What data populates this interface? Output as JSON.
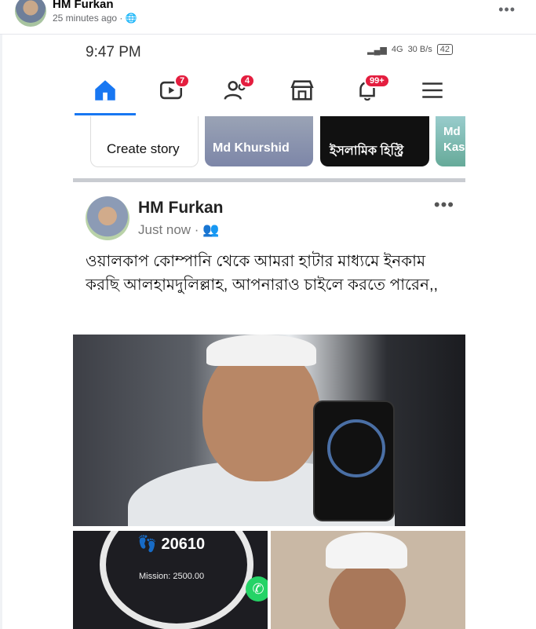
{
  "outer_post": {
    "author": "HM Furkan",
    "meta": "25 minutes ago · 🌐",
    "more": "•••"
  },
  "status_bar": {
    "time": "9:47 PM",
    "network": "4G",
    "speed": "30 B/s",
    "battery": "42"
  },
  "nav": {
    "items": [
      {
        "name": "home",
        "badge": ""
      },
      {
        "name": "video",
        "badge": "7"
      },
      {
        "name": "friends",
        "badge": "4"
      },
      {
        "name": "marketplace",
        "badge": ""
      },
      {
        "name": "notifications",
        "badge": "99+"
      },
      {
        "name": "menu",
        "badge": ""
      }
    ]
  },
  "stories": {
    "create": "Create story",
    "items": [
      "Md Khurshid",
      "ইসলামিক হিস্ট্রি",
      "Md Kas"
    ]
  },
  "post": {
    "author": "HM Furkan",
    "meta": "Just now ·",
    "more": "•••",
    "text": "ওয়ালকাপ কোম্পানি থেকে আমরা হাটার মাধ্যমে ইনকাম করছি আলহামদুলিল্লাহ, আপনারাও চাইলে করতে পারেন,,",
    "steps": "20610",
    "mission": "Mission: 2500.00"
  },
  "colors": {
    "accent": "#1877f2",
    "badge": "#e41e3f"
  }
}
